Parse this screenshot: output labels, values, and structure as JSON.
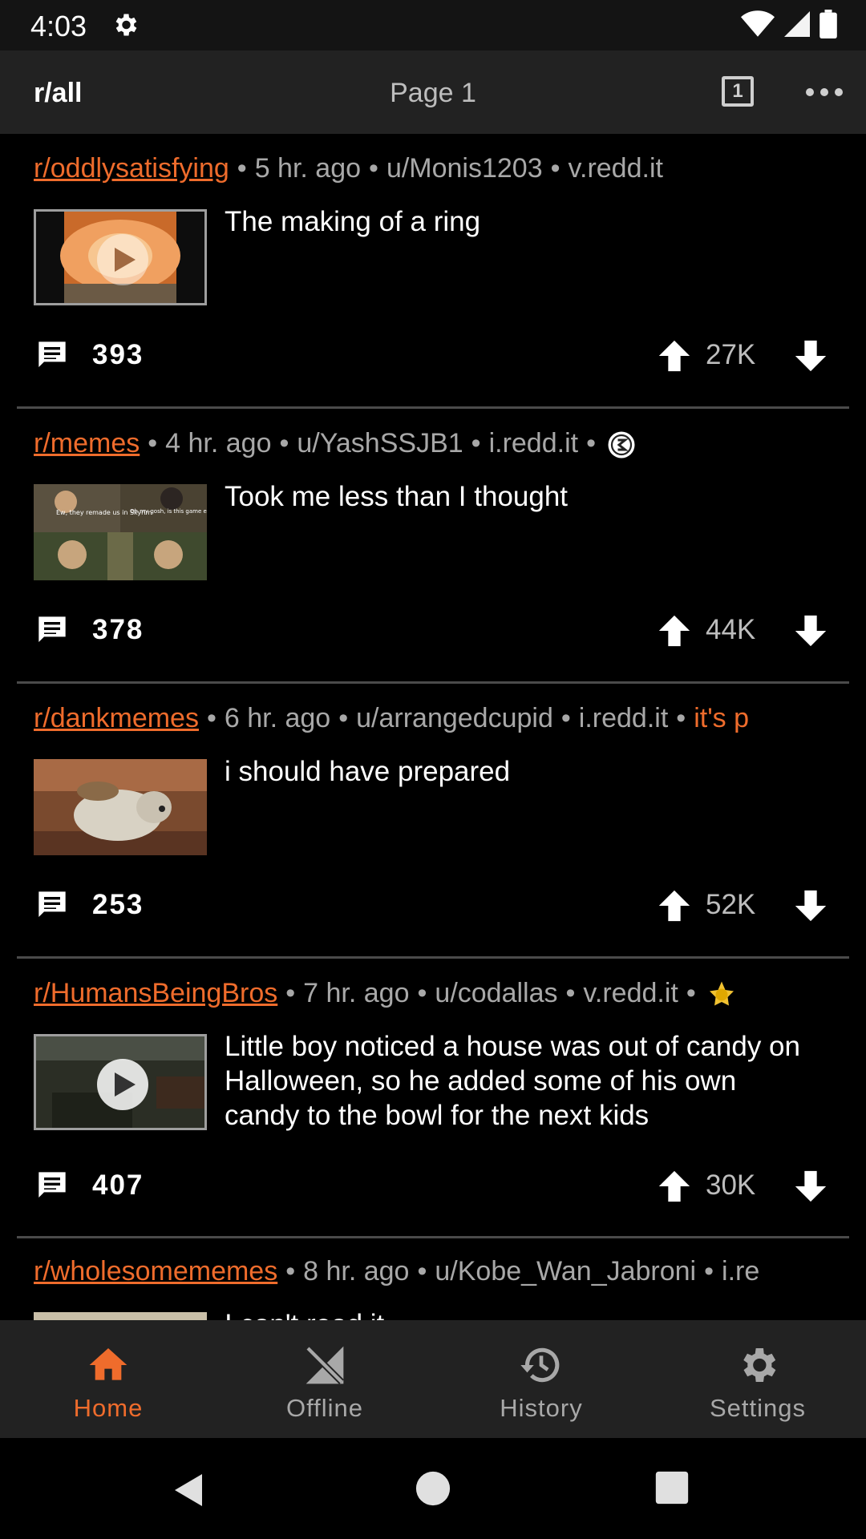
{
  "status_bar": {
    "time": "4:03"
  },
  "toolbar": {
    "title": "r/all",
    "page_label": "Page 1",
    "page_count_badge": "1"
  },
  "posts": [
    {
      "subreddit": "r/oddlysatisfying",
      "age": "5 hr. ago",
      "author": "u/Monis1203",
      "domain": "v.redd.it",
      "title": "The making of a ring",
      "comments": "393",
      "score": "27K",
      "thumb_type": "video-orange"
    },
    {
      "subreddit": "r/memes",
      "age": "4 hr. ago",
      "author": "u/YashSSJB1",
      "domain": "i.redd.it",
      "title": "Took me less than I thought",
      "comments": "378",
      "score": "44K",
      "thumb_type": "meme",
      "thumb_text_left": "Ew, they remade us in Skyrim",
      "thumb_text_right": "Oh my gosh, is this game even relevant?"
    },
    {
      "subreddit": "r/dankmemes",
      "age": "6 hr. ago",
      "author": "u/arrangedcupid",
      "domain": "i.redd.it",
      "flair": "it's p",
      "title": "i should have prepared",
      "comments": "253",
      "score": "52K",
      "thumb_type": "dog"
    },
    {
      "subreddit": "r/HumansBeingBros",
      "age": "7 hr. ago",
      "author": "u/codallas",
      "domain": "v.redd.it",
      "title": "Little boy noticed a house was out of candy on Halloween, so he added some of his own candy to the bowl for the next kids",
      "comments": "407",
      "score": "30K",
      "thumb_type": "video-dark"
    },
    {
      "subreddit": "r/wholesomememes",
      "age": "8 hr. ago",
      "author": "u/Kobe_Wan_Jabroni",
      "domain": "i.re",
      "title": "I can't read it...",
      "comments": "",
      "score": ""
    }
  ],
  "bottom_nav": [
    {
      "label": "Home",
      "icon": "home-icon",
      "active": true
    },
    {
      "label": "Offline",
      "icon": "offline-icon",
      "active": false
    },
    {
      "label": "History",
      "icon": "history-icon",
      "active": false
    },
    {
      "label": "Settings",
      "icon": "settings-icon",
      "active": false
    }
  ],
  "colors": {
    "accent": "#ef6c2c",
    "toolbar_bg": "#222222",
    "background": "#000000"
  }
}
